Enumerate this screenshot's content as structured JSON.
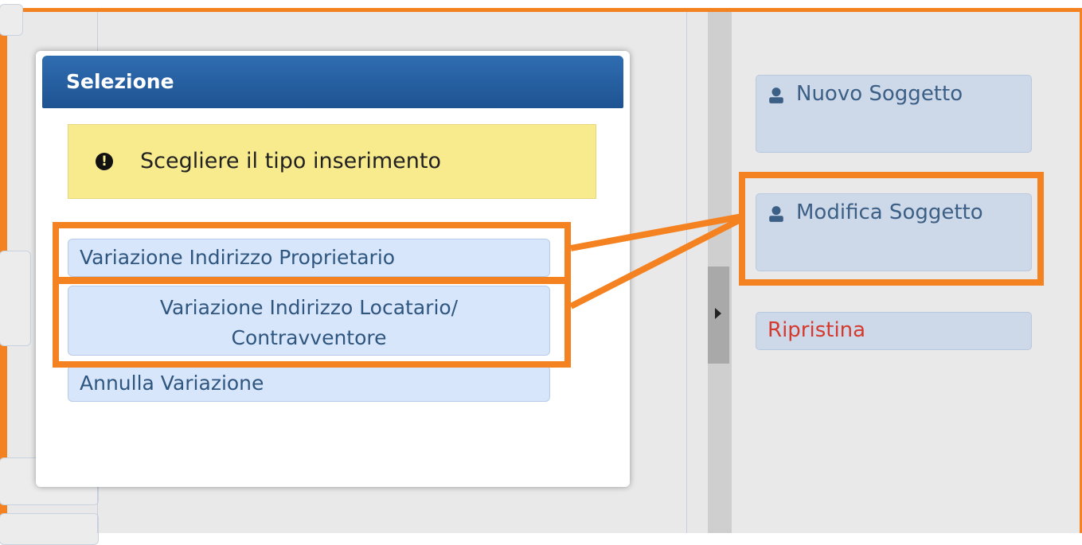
{
  "modal": {
    "title": "Selezione",
    "alert_text": "Scegliere il tipo inserimento",
    "alert_icon": "exclamation-circle-icon",
    "options": [
      "Variazione Indirizzo Proprietario",
      "Variazione Indirizzo Locatario/",
      "Contravventore",
      "Annulla Variazione"
    ]
  },
  "sidebar": {
    "new_subject": "Nuovo Soggetto",
    "edit_subject": "Modifica Soggetto",
    "restore": "Ripristina",
    "person_icon": "person-icon"
  },
  "colors": {
    "highlight": "#f58220",
    "header_blue": "#1e5392",
    "alert_yellow": "#f8eb8e",
    "option_blue": "#d8e6fb",
    "restore_red": "#d53a2e"
  }
}
